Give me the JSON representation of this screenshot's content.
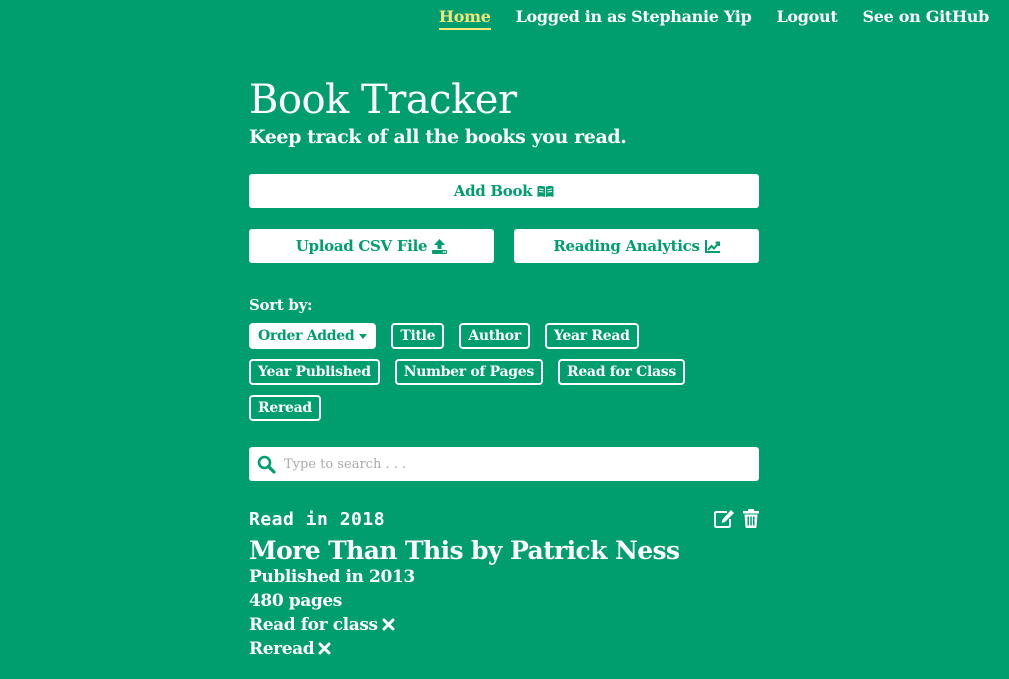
{
  "nav": {
    "home": "Home",
    "user": "Logged in as Stephanie Yip",
    "logout": "Logout",
    "github": "See on GitHub"
  },
  "header": {
    "title": "Book Tracker",
    "subtitle": "Keep track of all the books you read."
  },
  "actions": {
    "add_book": "Add Book",
    "upload_csv": "Upload CSV File",
    "analytics": "Reading Analytics"
  },
  "sort": {
    "label": "Sort by:",
    "options": [
      "Order Added",
      "Title",
      "Author",
      "Year Read",
      "Year Published",
      "Number of Pages",
      "Read for Class",
      "Reread"
    ],
    "active": "Order Added"
  },
  "search": {
    "placeholder": "Type to search . . ."
  },
  "books": [
    {
      "year_read": "Read in 2018",
      "title": "More Than This by Patrick Ness",
      "published": "Published in 2013",
      "pages": "480 pages",
      "read_for_class": "Read for class",
      "reread": "Reread"
    }
  ],
  "colors": {
    "background": "#009e6e",
    "accent_active": "#f3e97a",
    "text": "#ffffff"
  },
  "icons": [
    "open-book-icon",
    "upload-icon",
    "chart-icon",
    "caret-down-icon",
    "search-icon",
    "edit-icon",
    "trash-icon",
    "x-icon"
  ]
}
